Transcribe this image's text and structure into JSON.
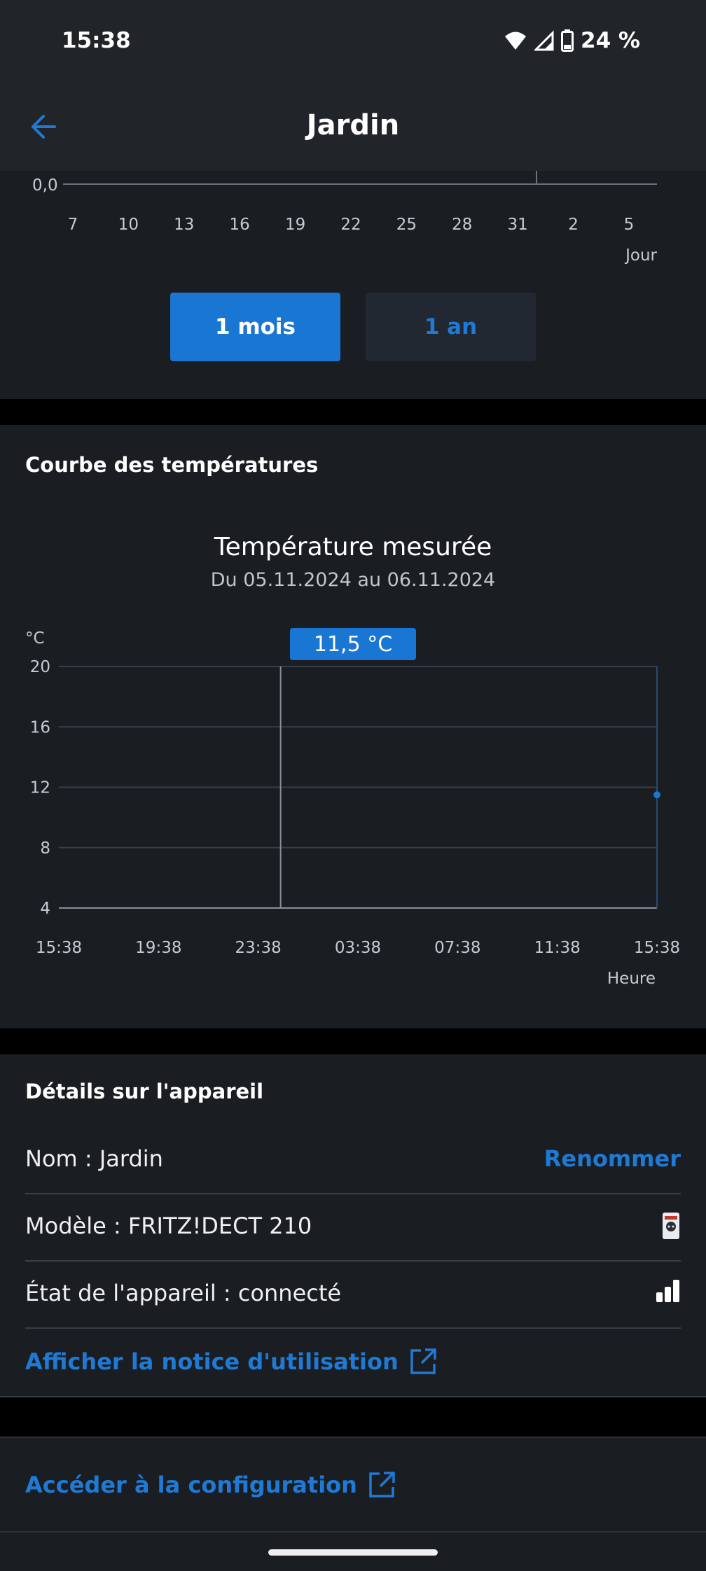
{
  "status_bar": {
    "time": "15:38",
    "battery": "24 %"
  },
  "header": {
    "title": "Jardin"
  },
  "energy_chart": {
    "y_tick": "0,0",
    "x_ticks": [
      "7",
      "10",
      "13",
      "16",
      "19",
      "22",
      "25",
      "28",
      "31",
      "2",
      "5"
    ],
    "x_unit": "Jour",
    "range_buttons": {
      "month": "1 mois",
      "year": "1 an",
      "selected": "month"
    }
  },
  "temperature": {
    "section_title": "Courbe des températures",
    "chart_title": "Température mesurée",
    "subtitle": "Du 05.11.2024 au 06.11.2024",
    "tooltip": "11,5 °C",
    "y_unit": "°C",
    "x_unit": "Heure"
  },
  "chart_data": {
    "type": "line",
    "title": "Température mesurée",
    "subtitle": "Du 05.11.2024 au 06.11.2024",
    "ylabel": "°C",
    "xlabel": "Heure",
    "ylim": [
      4,
      20
    ],
    "y_ticks": [
      20,
      16,
      12,
      8,
      4
    ],
    "x_ticks": [
      "15:38",
      "19:38",
      "23:38",
      "03:38",
      "07:38",
      "11:38",
      "15:38"
    ],
    "grid": true,
    "cursor_x": "23:38",
    "series": [
      {
        "points": [
          {
            "x": "15:38",
            "y": 11.5
          }
        ],
        "color": "#1976d2"
      }
    ]
  },
  "device_details": {
    "section_title": "Détails sur l'appareil",
    "name_label": "Nom :  Jardin",
    "rename": "Renommer",
    "model_label": "Modèle : FRITZ!DECT 210",
    "state_label": "État de l'appareil : connecté",
    "manual_link": "Afficher la notice d'utilisation"
  },
  "config_link": "Accéder à la configuration",
  "colors": {
    "accent": "#1976d2",
    "card": "#1a1d21",
    "header": "#212429"
  }
}
